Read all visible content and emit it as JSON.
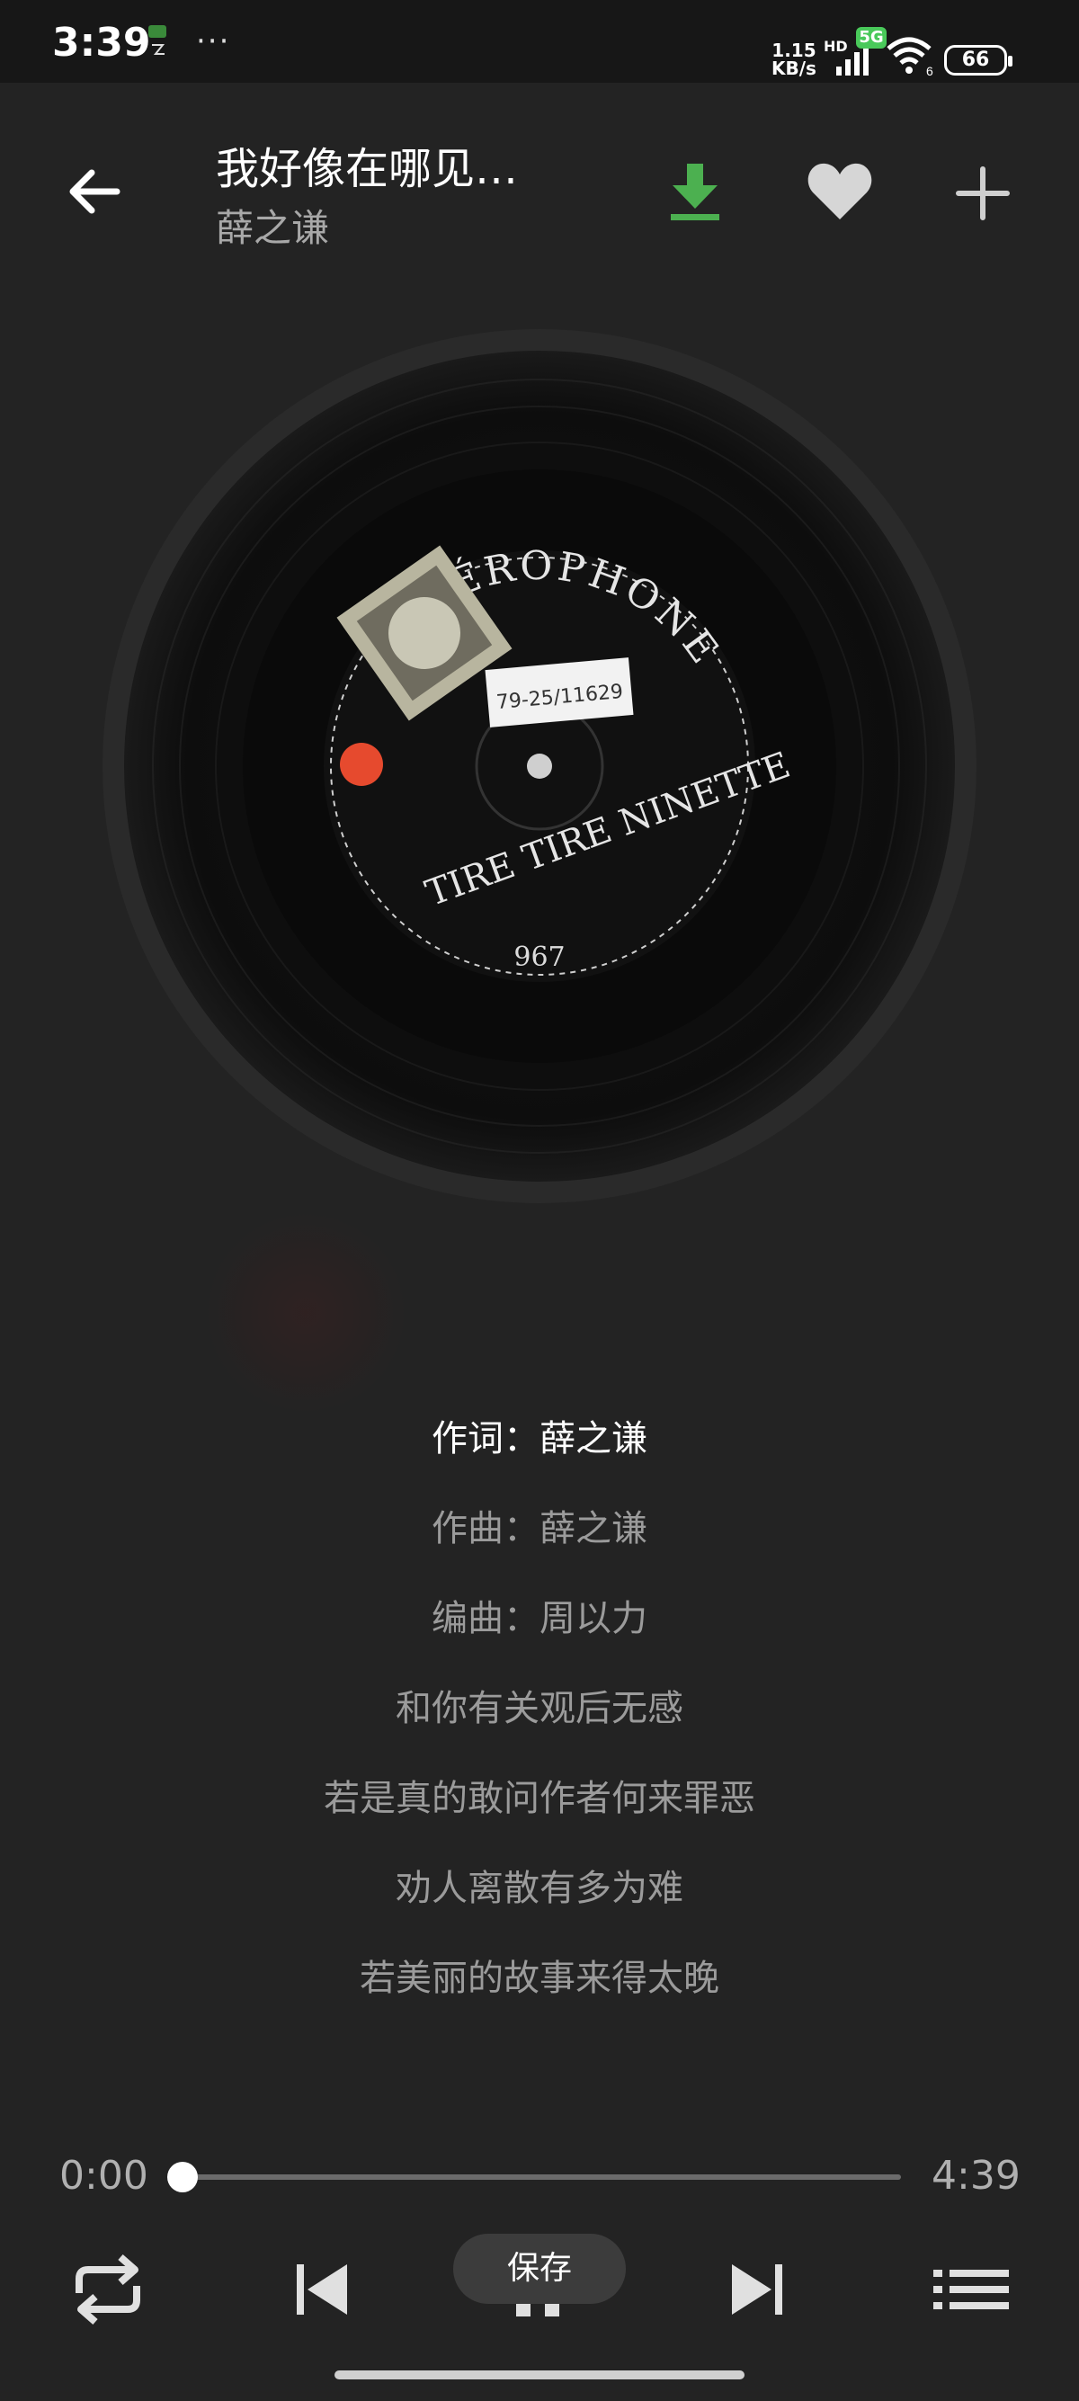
{
  "status_bar": {
    "time": "3:39",
    "more": "···",
    "net_speed_value": "1.15",
    "net_speed_unit": "KB/s",
    "hd_label": "HD",
    "network_badge": "5G",
    "wifi_label": "6",
    "battery": "66"
  },
  "header": {
    "song_title": "我好像在哪见…",
    "artist": "薛之谦",
    "download_color": "#4cb050"
  },
  "record": {
    "label_text": "AÉROPHONE",
    "label_song": "TIRE TIRE NINETTE",
    "label_number": "967",
    "sticker": "79-25/11629"
  },
  "lyrics": [
    {
      "text": "作词：薛之谦",
      "active": true
    },
    {
      "text": "作曲：薛之谦",
      "active": false
    },
    {
      "text": "编曲：周以力",
      "active": false
    },
    {
      "text": "和你有关观后无感",
      "active": false
    },
    {
      "text": "若是真的敢问作者何来罪恶",
      "active": false
    },
    {
      "text": "劝人离散有多为难",
      "active": false
    },
    {
      "text": "若美丽的故事来得太晚",
      "active": false
    }
  ],
  "player": {
    "current_time": "0:00",
    "total_time": "4:39",
    "progress": 0.0,
    "save_label": "保存"
  }
}
